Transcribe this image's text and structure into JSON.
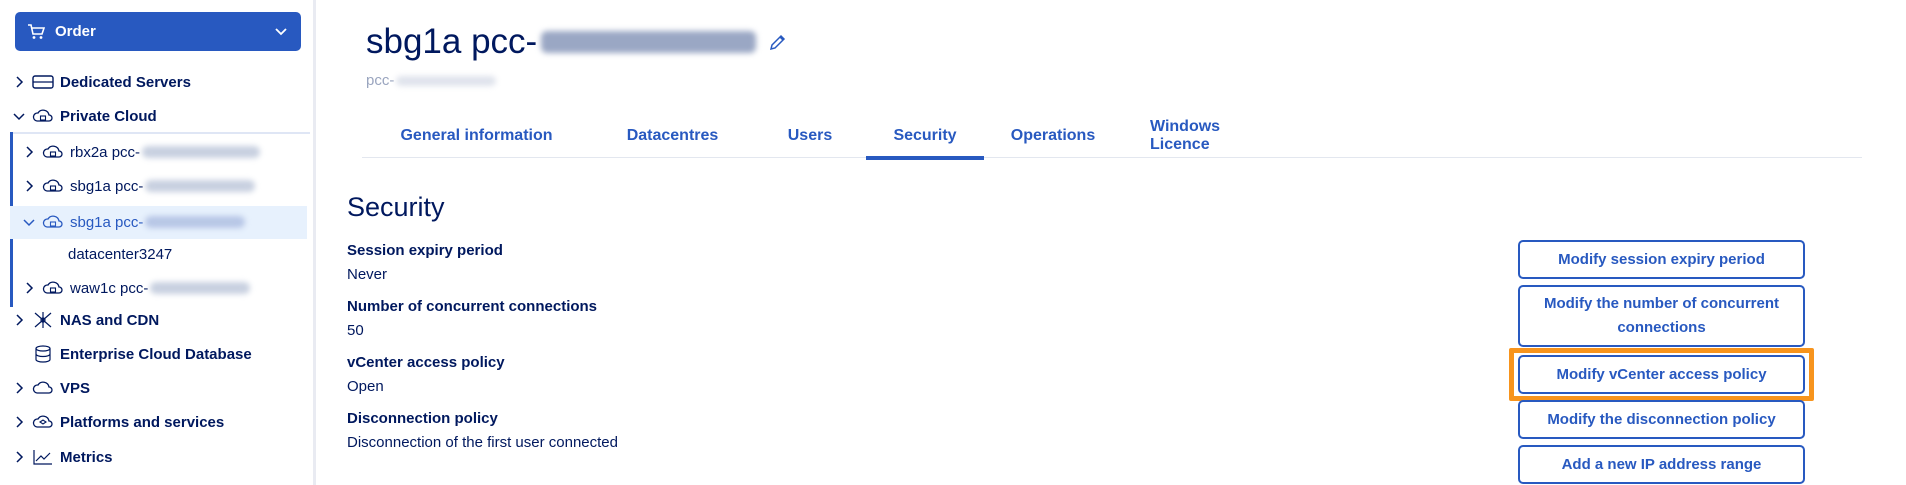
{
  "sidebar": {
    "order_label": "Order",
    "items": [
      {
        "label": "Dedicated Servers"
      },
      {
        "label": "Private Cloud"
      },
      {
        "label": "rbx2a pcc-"
      },
      {
        "label": "sbg1a pcc-"
      },
      {
        "label": "sbg1a pcc-"
      },
      {
        "label": "datacenter3247"
      },
      {
        "label": "waw1c pcc-"
      },
      {
        "label": "NAS and CDN"
      },
      {
        "label": "Enterprise Cloud Database"
      },
      {
        "label": "VPS"
      },
      {
        "label": "Platforms and services"
      },
      {
        "label": "Metrics"
      }
    ]
  },
  "header": {
    "title": "sbg1a pcc-",
    "subtitle": "pcc-"
  },
  "tabs": [
    {
      "label": "General information"
    },
    {
      "label": "Datacentres"
    },
    {
      "label": "Users"
    },
    {
      "label": "Security"
    },
    {
      "label": "Operations"
    },
    {
      "label": "Windows Licence"
    }
  ],
  "security": {
    "title": "Security",
    "fields": [
      {
        "label": "Session expiry period",
        "value": "Never"
      },
      {
        "label": "Number of concurrent connections",
        "value": "50"
      },
      {
        "label": "vCenter access policy",
        "value": "Open"
      },
      {
        "label": "Disconnection policy",
        "value": "Disconnection of the first user connected"
      }
    ],
    "actions": [
      {
        "label": "Modify session expiry period"
      },
      {
        "label": "Modify the number of concurrent connections"
      },
      {
        "label": "Modify vCenter access policy"
      },
      {
        "label": "Modify the disconnection policy"
      },
      {
        "label": "Add a new IP address range"
      }
    ]
  },
  "colors": {
    "primary": "#2859c0",
    "text": "#00185e",
    "highlight": "#f7941d"
  }
}
